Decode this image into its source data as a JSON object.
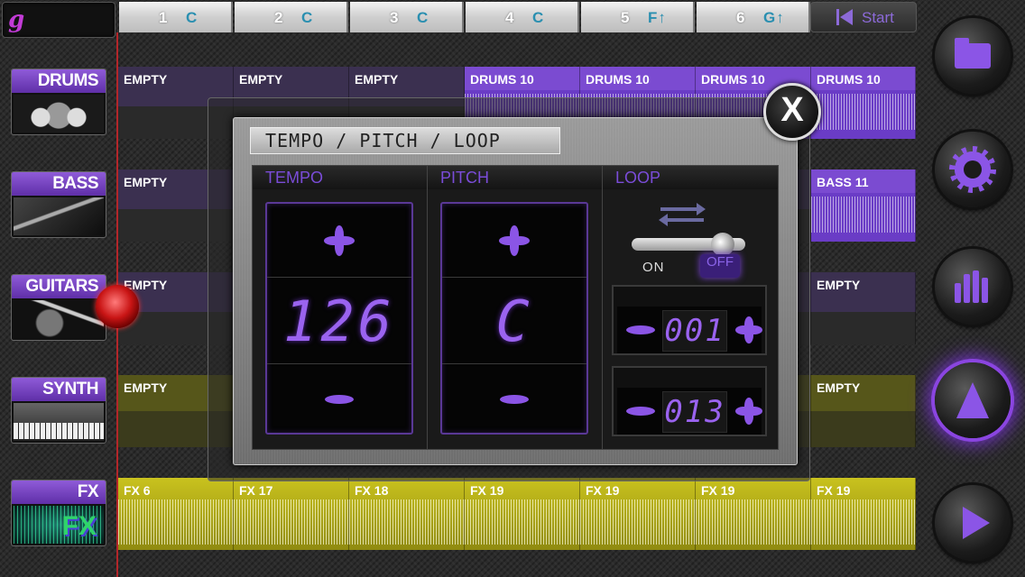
{
  "logo": {
    "letter": "g"
  },
  "segments": [
    {
      "num": "1",
      "key": "C"
    },
    {
      "num": "2",
      "key": "C"
    },
    {
      "num": "3",
      "key": "C"
    },
    {
      "num": "4",
      "key": "C"
    },
    {
      "num": "5",
      "key": "F↑"
    },
    {
      "num": "6",
      "key": "G↑"
    }
  ],
  "start_label": "Start",
  "tracks": [
    {
      "name": "DRUMS"
    },
    {
      "name": "BASS"
    },
    {
      "name": "GUITARS"
    },
    {
      "name": "SYNTH"
    },
    {
      "name": "FX"
    }
  ],
  "fx_logo": "FX",
  "lanes": {
    "drums": [
      "EMPTY",
      "EMPTY",
      "EMPTY",
      "DRUMS 10",
      "DRUMS 10",
      "DRUMS 10",
      "DRUMS 10"
    ],
    "bass": [
      "EMPTY",
      "BASS 11"
    ],
    "guitars": [
      "EMPTY",
      "EMPTY"
    ],
    "synth": [
      "EMPTY",
      "EMPTY"
    ],
    "fx": [
      "FX 6",
      "FX 17",
      "FX 18",
      "FX 19",
      "FX 19",
      "FX 19",
      "FX 19"
    ]
  },
  "dialog": {
    "title": "TEMPO / PITCH / LOOP",
    "close_label": "X",
    "tempo": {
      "header": "TEMPO",
      "value": "126"
    },
    "pitch": {
      "header": "PITCH",
      "value": "C"
    },
    "loop": {
      "header": "LOOP",
      "on_label": "ON",
      "off_label": "OFF",
      "state": "OFF",
      "start_value": "001",
      "end_value": "013"
    }
  },
  "colors": {
    "accent": "#8b55e6",
    "playhead": "#b3262a",
    "fx_lane": "#c9c21e"
  }
}
